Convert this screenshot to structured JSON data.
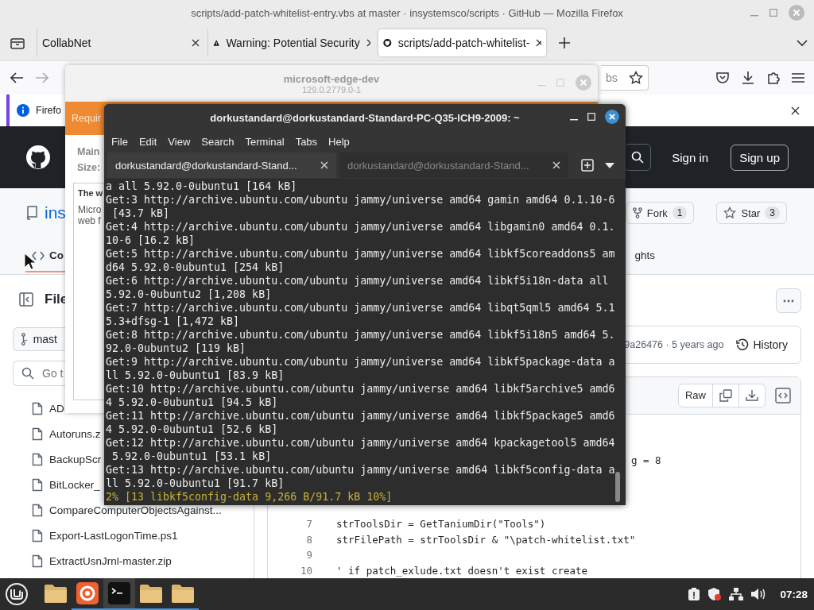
{
  "firefox": {
    "title": "scripts/add-patch-whitelist-entry.vbs at master · insystemsco/scripts · GitHub — Mozilla Firefox",
    "tabs": [
      {
        "label": "CollabNet",
        "kind": "plain",
        "selected": false
      },
      {
        "label": "Warning: Potential Security",
        "kind": "warning",
        "selected": false
      },
      {
        "label": "scripts/add-patch-whitelist-",
        "kind": "github",
        "selected": true
      }
    ],
    "url_fragment": "bs",
    "notification": "Firefo"
  },
  "github": {
    "sign_in": "Sign in",
    "sign_up": "Sign up",
    "repo_name": "ins",
    "fork": {
      "label": "Fork",
      "count": "1"
    },
    "star": {
      "label": "Star",
      "count": "3"
    },
    "nav_tabs": [
      {
        "label": "Co",
        "selected": true
      },
      {
        "label": "ghts",
        "selected": false
      }
    ],
    "sidebar": {
      "title": "File",
      "branch": "mast",
      "search_placeholder": "Go t",
      "files": [
        "AD",
        "Autoruns.z",
        "BackupScr",
        "BitLocker_",
        "CompareComputerObjectsAgainst...",
        "Export-LastLogonTime.ps1",
        "ExtractUsnJrnl-master.zip"
      ]
    },
    "commit": {
      "info": "9a26476 · 5 years ago",
      "history": "History"
    },
    "raw": "Raw",
    "code": {
      "fragment": "g = 8",
      "lines": [
        {
          "number": "7",
          "text": "strToolsDir = GetTaniumDir(\"Tools\")"
        },
        {
          "number": "8",
          "text": "strFilePath = strToolsDir & \"\\patch-whitelist.txt\""
        },
        {
          "number": "9"
        },
        {
          "number": "10",
          "text": "' if patch_exlude.txt doesn't exist create"
        }
      ]
    }
  },
  "installer": {
    "title": "microsoft-edge-dev",
    "version": "129.0.2779.0-1",
    "banner": "Requir",
    "fields": [
      "Main",
      "Size:"
    ],
    "description_title": "The w",
    "description": [
      "Micro",
      "web f"
    ]
  },
  "terminal": {
    "title": "dorkustandard@dorkustandard-Standard-PC-Q35-ICH9-2009: ~",
    "menu": [
      "File",
      "Edit",
      "View",
      "Search",
      "Terminal",
      "Tabs",
      "Help"
    ],
    "tabs": [
      {
        "label": "dorkustandard@dorkustandard-Stand...",
        "selected": true
      },
      {
        "label": "dorkustandard@dorkustandard-Stand...",
        "selected": false
      }
    ],
    "lines": [
      "a all 5.92.0-0ubuntu1 [164 kB]",
      "Get:3 http://archive.ubuntu.com/ubuntu jammy/universe amd64 gamin amd64 0.1.10-6",
      " [43.7 kB]",
      "Get:4 http://archive.ubuntu.com/ubuntu jammy/universe amd64 libgamin0 amd64 0.1.",
      "10-6 [16.2 kB]",
      "Get:5 http://archive.ubuntu.com/ubuntu jammy/universe amd64 libkf5coreaddons5 am",
      "d64 5.92.0-0ubuntu1 [254 kB]",
      "Get:6 http://archive.ubuntu.com/ubuntu jammy/universe amd64 libkf5i18n-data all",
      "5.92.0-0ubuntu2 [1,208 kB]",
      "Get:7 http://archive.ubuntu.com/ubuntu jammy/universe amd64 libqt5qml5 amd64 5.1",
      "5.3+dfsg-1 [1,472 kB]",
      "Get:8 http://archive.ubuntu.com/ubuntu jammy/universe amd64 libkf5i18n5 amd64 5.",
      "92.0-0ubuntu2 [119 kB]",
      "Get:9 http://archive.ubuntu.com/ubuntu jammy/universe amd64 libkf5package-data a",
      "ll 5.92.0-0ubuntu1 [83.9 kB]",
      "Get:10 http://archive.ubuntu.com/ubuntu jammy/universe amd64 libkf5archive5 amd6",
      "4 5.92.0-0ubuntu1 [94.5 kB]",
      "Get:11 http://archive.ubuntu.com/ubuntu jammy/universe amd64 libkf5package5 amd6",
      "4 5.92.0-0ubuntu1 [52.6 kB]",
      "Get:12 http://archive.ubuntu.com/ubuntu jammy/universe amd64 kpackagetool5 amd64",
      " 5.92.0-0ubuntu1 [53.1 kB]",
      "Get:13 http://archive.ubuntu.com/ubuntu jammy/universe amd64 libkf5config-data a",
      "ll 5.92.0-0ubuntu1 [91.7 kB]"
    ],
    "progress": "2% [13 libkf5config-data 9,266 B/91.7 kB 10%]"
  },
  "taskbar": {
    "apps": [
      {
        "kind": "folder",
        "running": false,
        "focused": false
      },
      {
        "kind": "firefox",
        "running": true,
        "focused": false
      },
      {
        "kind": "terminal",
        "running": true,
        "focused": true
      },
      {
        "kind": "folder",
        "running": true,
        "focused": false
      },
      {
        "kind": "folder",
        "running": true,
        "focused": false
      }
    ],
    "clock": "07:28"
  }
}
